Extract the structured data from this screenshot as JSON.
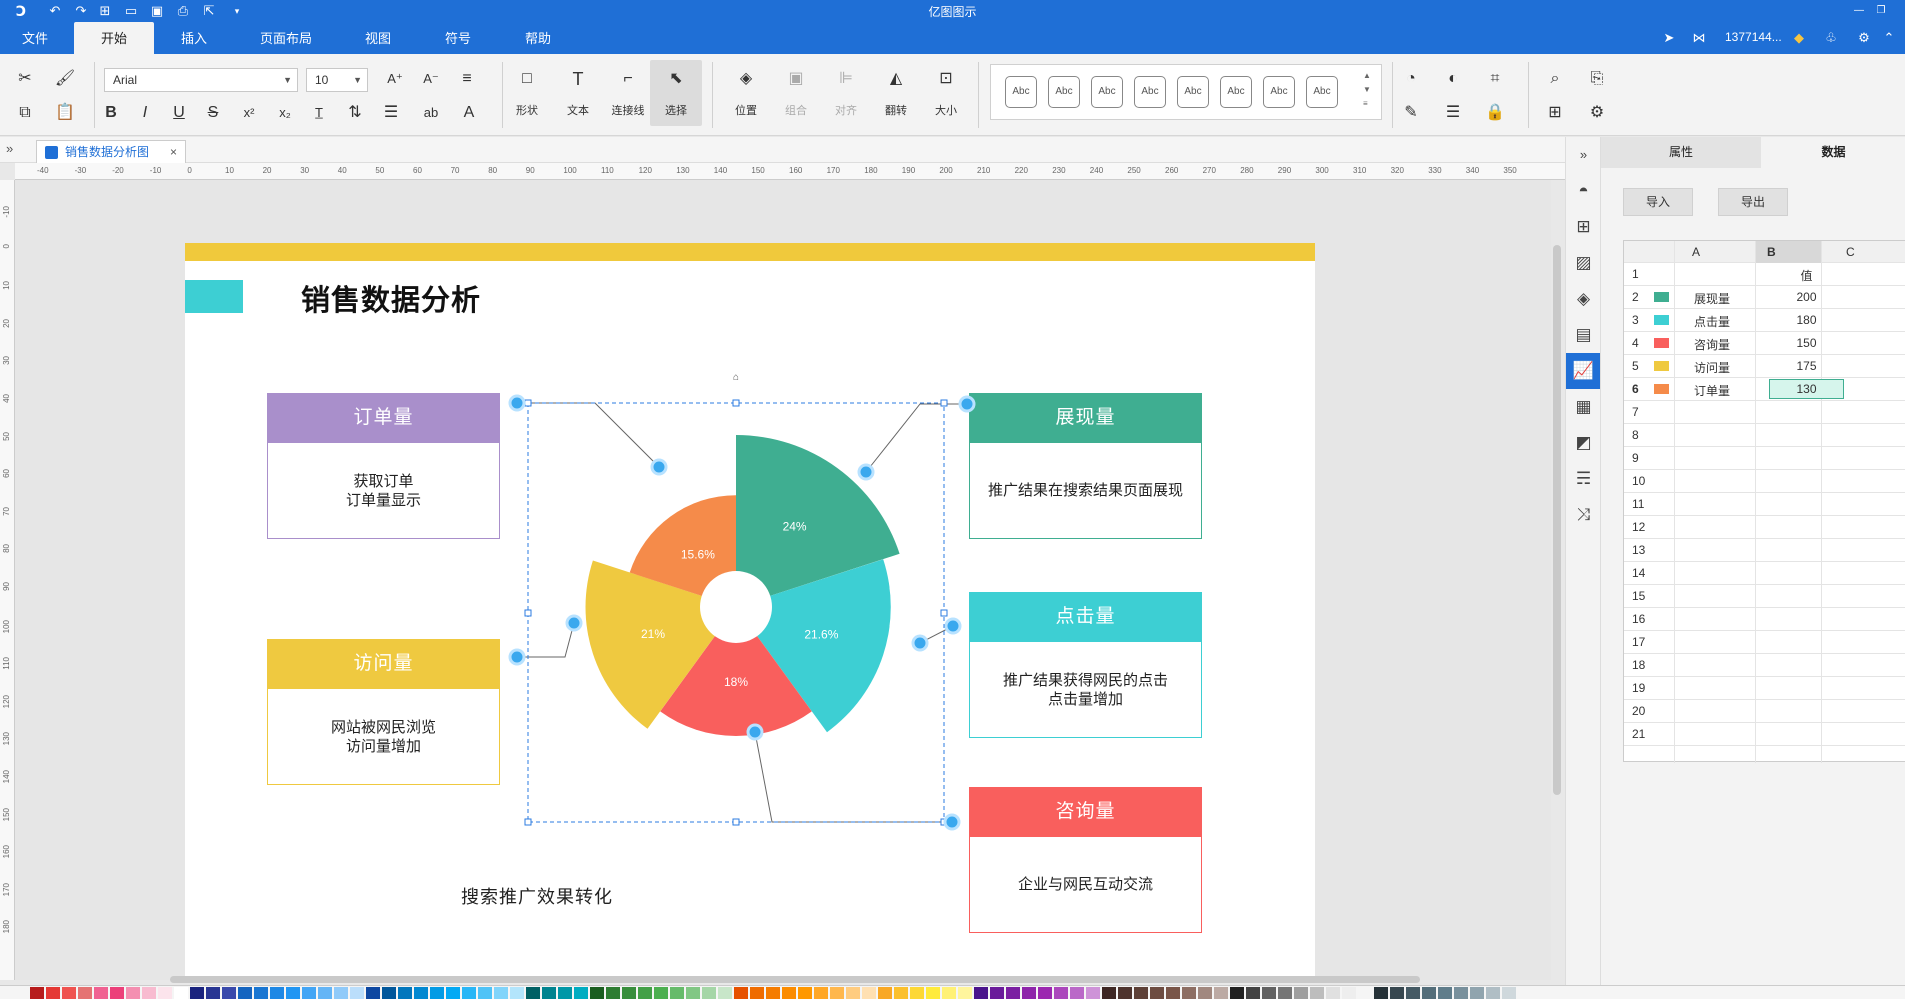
{
  "app": {
    "title": "亿图图示",
    "user": "1377144...",
    "menus": [
      "文件",
      "开始",
      "插入",
      "页面布局",
      "视图",
      "符号",
      "帮助"
    ],
    "active_menu_index": 1
  },
  "ribbon": {
    "font_name": "Arial",
    "font_size": "10",
    "shape_label": "形状",
    "text_label": "文本",
    "connector_label": "连接线",
    "select_label": "选择",
    "position_label": "位置",
    "group_label": "组合",
    "align_label": "对齐",
    "flip_label": "翻转",
    "size_label": "大小",
    "style_sample": "Abc"
  },
  "tab": {
    "doc_name": "销售数据分析图"
  },
  "ruler": {
    "h_ticks": [
      "-40",
      "-30",
      "-20",
      "-10",
      "0",
      "10",
      "20",
      "30",
      "40",
      "50",
      "60",
      "70",
      "80",
      "90",
      "100",
      "110",
      "120",
      "130",
      "140",
      "150",
      "160",
      "170",
      "180",
      "190",
      "200",
      "210",
      "220",
      "230",
      "240",
      "250",
      "260",
      "270",
      "280",
      "290",
      "300",
      "310",
      "320",
      "330",
      "340",
      "350"
    ],
    "v_ticks": [
      "-10",
      "0",
      "10",
      "20",
      "30",
      "40",
      "50",
      "60",
      "70",
      "80",
      "90",
      "100",
      "110",
      "120",
      "130",
      "140",
      "150",
      "160",
      "170",
      "180"
    ]
  },
  "page": {
    "title": "销售数据分析",
    "caption": "搜索推广效果转化",
    "cards": [
      {
        "key": "order",
        "title": "订单量",
        "lines": [
          "获取订单",
          "订单量显示"
        ],
        "color": "#a98fcb"
      },
      {
        "key": "visit",
        "title": "访问量",
        "lines": [
          "网站被网民浏览",
          "访问量增加"
        ],
        "color": "#efc940"
      },
      {
        "key": "show",
        "title": "展现量",
        "lines": [
          "推广结果在搜索结果页面展现"
        ],
        "color": "#3fae91"
      },
      {
        "key": "click",
        "title": "点击量",
        "lines": [
          "推广结果获得网民的点击",
          "点击量增加"
        ],
        "color": "#3dcfd3"
      },
      {
        "key": "consult",
        "title": "咨询量",
        "lines": [
          "企业与网民互动交流"
        ],
        "color": "#f95f5d"
      }
    ]
  },
  "chart_data": {
    "type": "pie",
    "subtype": "rose",
    "categories": [
      "展现量",
      "点击量",
      "咨询量",
      "访问量",
      "订单量"
    ],
    "values": [
      200,
      180,
      150,
      175,
      130
    ],
    "percent_labels": [
      "24%",
      "21.6%",
      "18%",
      "21%",
      "15.6%"
    ],
    "colors": [
      "#3fae91",
      "#3dcfd3",
      "#f95f5d",
      "#efc940",
      "#f58b4a"
    ]
  },
  "panel": {
    "tabs": [
      "属性",
      "数据"
    ],
    "active_tab_index": 1,
    "import_label": "导入",
    "export_label": "导出",
    "columns": [
      "A",
      "B",
      "C"
    ],
    "header_value": "值",
    "rows": [
      {
        "n": "2",
        "name": "展现量",
        "value": "200",
        "color": "#3fae91"
      },
      {
        "n": "3",
        "name": "点击量",
        "value": "180",
        "color": "#3dcfd3"
      },
      {
        "n": "4",
        "name": "咨询量",
        "value": "150",
        "color": "#f95f5d"
      },
      {
        "n": "5",
        "name": "访问量",
        "value": "175",
        "color": "#efc940"
      },
      {
        "n": "6",
        "name": "订单量",
        "value": "130",
        "color": "#f58b4a"
      }
    ],
    "empty_rows": [
      "7",
      "8",
      "9",
      "10",
      "11",
      "12",
      "13",
      "14",
      "15",
      "16",
      "17",
      "18",
      "19",
      "20",
      "21"
    ],
    "selected_row": "6"
  },
  "palette_colors": [
    "#b71c1c",
    "#e53935",
    "#ef5350",
    "#e57373",
    "#f06292",
    "#ec407a",
    "#f48fb1",
    "#f8bbd0",
    "#fce4ec",
    "#ffffff",
    "#1a237e",
    "#283593",
    "#3949ab",
    "#1565c0",
    "#1976d2",
    "#1e88e5",
    "#2196f3",
    "#42a5f5",
    "#64b5f6",
    "#90caf9",
    "#bbdefb",
    "#0d47a1",
    "#01579b",
    "#0277bd",
    "#0288d1",
    "#039be5",
    "#03a9f4",
    "#29b6f6",
    "#4fc3f7",
    "#81d4fa",
    "#b3e5fc",
    "#006064",
    "#00838f",
    "#0097a7",
    "#00acc1",
    "#1b5e20",
    "#2e7d32",
    "#388e3c",
    "#43a047",
    "#4caf50",
    "#66bb6a",
    "#81c784",
    "#a5d6a7",
    "#c8e6c9",
    "#e65100",
    "#ef6c00",
    "#f57c00",
    "#fb8c00",
    "#ff9800",
    "#ffa726",
    "#ffb74d",
    "#ffcc80",
    "#ffe0b2",
    "#f9a825",
    "#fbc02d",
    "#fdd835",
    "#ffeb3b",
    "#fff176",
    "#fff59d",
    "#4a148c",
    "#6a1b9a",
    "#7b1fa2",
    "#8e24aa",
    "#9c27b0",
    "#ab47bc",
    "#ba68c8",
    "#ce93d8",
    "#3e2723",
    "#4e342e",
    "#5d4037",
    "#6d4c41",
    "#795548",
    "#8d6e63",
    "#a1887f",
    "#bcaaa4",
    "#212121",
    "#424242",
    "#616161",
    "#757575",
    "#9e9e9e",
    "#bdbdbd",
    "#e0e0e0",
    "#eeeeee",
    "#f5f5f5",
    "#263238",
    "#37474f",
    "#455a64",
    "#546e7a",
    "#607d8b",
    "#78909c",
    "#90a4ae",
    "#b0bec5",
    "#cfd8dc"
  ]
}
